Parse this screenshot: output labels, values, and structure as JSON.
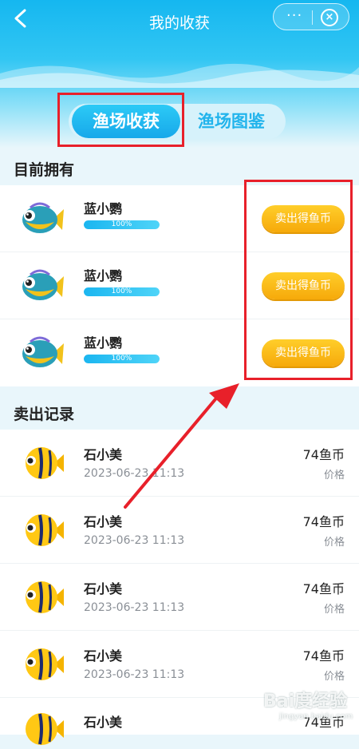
{
  "header": {
    "title": "我的收获",
    "more": "···",
    "close": "×"
  },
  "tabs": [
    {
      "label": "渔场收获",
      "active": true
    },
    {
      "label": "渔场图鉴",
      "active": false
    }
  ],
  "owned": {
    "section_title": "目前拥有",
    "items": [
      {
        "name": "蓝小鹦",
        "progress_text": "100%",
        "progress": 1.0,
        "button": "卖出得鱼币",
        "fish_icon": "blue-parrot-fish-icon"
      },
      {
        "name": "蓝小鹦",
        "progress_text": "100%",
        "progress": 1.0,
        "button": "卖出得鱼币",
        "fish_icon": "blue-parrot-fish-icon"
      },
      {
        "name": "蓝小鹦",
        "progress_text": "100%",
        "progress": 1.0,
        "button": "卖出得鱼币",
        "fish_icon": "blue-parrot-fish-icon"
      }
    ]
  },
  "records": {
    "section_title": "卖出记录",
    "items": [
      {
        "name": "石小美",
        "date": "2023-06-23 11:13",
        "price": "74鱼币",
        "price_label": "价格",
        "fish_icon": "yellow-butterfly-fish-icon"
      },
      {
        "name": "石小美",
        "date": "2023-06-23 11:13",
        "price": "74鱼币",
        "price_label": "价格",
        "fish_icon": "yellow-butterfly-fish-icon"
      },
      {
        "name": "石小美",
        "date": "2023-06-23 11:13",
        "price": "74鱼币",
        "price_label": "价格",
        "fish_icon": "yellow-butterfly-fish-icon"
      },
      {
        "name": "石小美",
        "date": "2023-06-23 11:13",
        "price": "74鱼币",
        "price_label": "价格",
        "fish_icon": "yellow-butterfly-fish-icon"
      },
      {
        "name": "石小美",
        "date": "",
        "price": "74鱼币",
        "price_label": "",
        "fish_icon": "yellow-butterfly-fish-icon"
      }
    ]
  },
  "watermark": {
    "text": "Bai度经验",
    "sub": "jingyan.baidu.com"
  },
  "colors": {
    "accent": "#17a8ea",
    "button": "#f6a90a",
    "annotation": "#e8202a"
  }
}
